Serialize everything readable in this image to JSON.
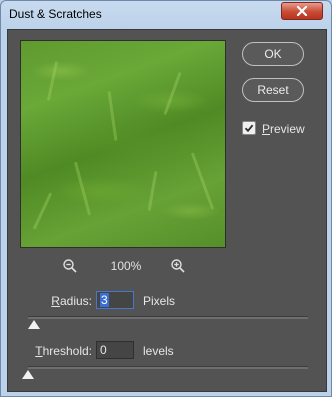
{
  "window": {
    "title": "Dust & Scratches",
    "close_icon": "close-icon"
  },
  "buttons": {
    "ok": "OK",
    "reset": "Reset"
  },
  "preview_toggle": {
    "label_underlined": "P",
    "label_rest": "review",
    "checked": true
  },
  "zoom": {
    "level": "100%",
    "zoom_out_icon": "zoom-out-icon",
    "zoom_in_icon": "zoom-in-icon"
  },
  "radius": {
    "label_underlined": "R",
    "label_rest": "adius:",
    "value": "3",
    "unit": "Pixels",
    "slider_fraction": 0.013
  },
  "threshold": {
    "label_underlined": "T",
    "label_rest": "hreshold:",
    "value": "0",
    "unit": "levels",
    "slider_fraction": 0.0
  },
  "colors": {
    "dialog_bg": "#535353",
    "title_bar": "#bcd2ea",
    "close_button": "#c84b34",
    "input_selection": "#3a6fd8"
  }
}
